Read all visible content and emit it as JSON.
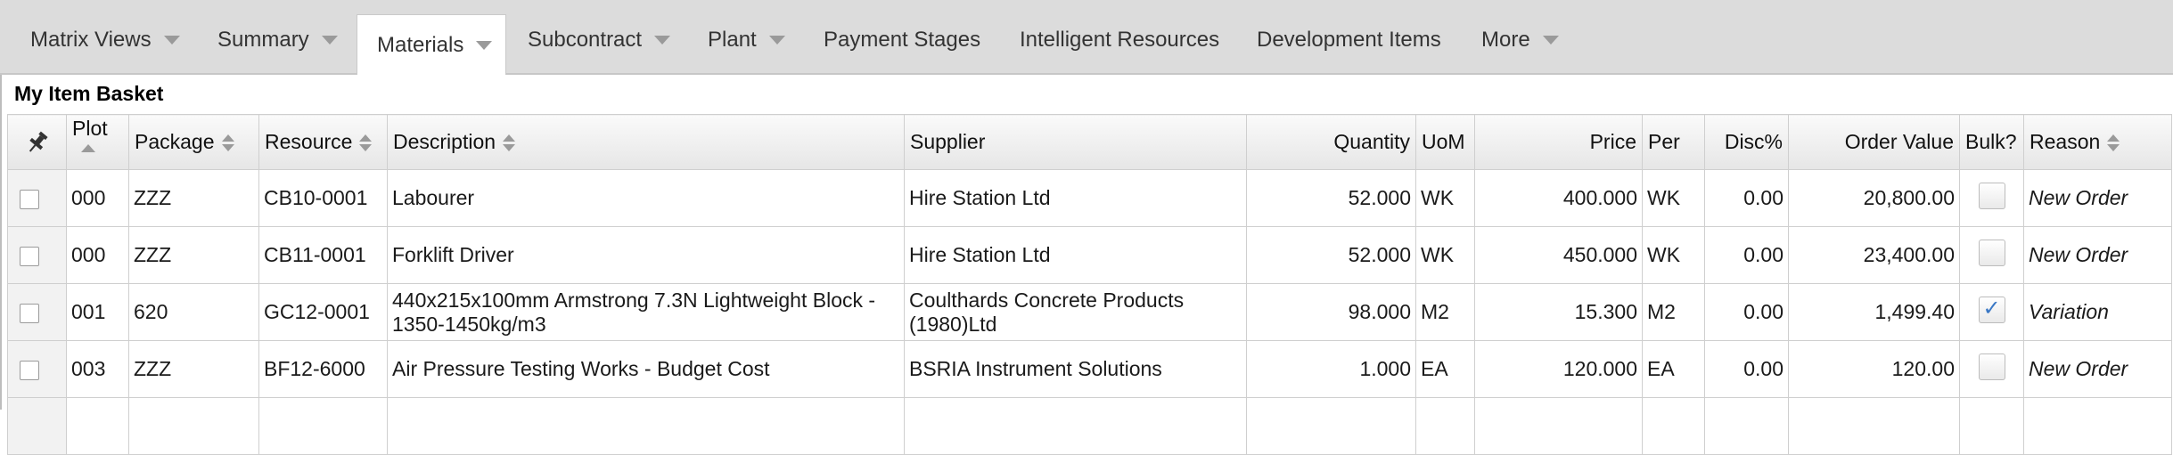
{
  "tabs": [
    {
      "label": "Matrix Views",
      "dropdown": true
    },
    {
      "label": "Summary",
      "dropdown": true
    },
    {
      "label": "Materials",
      "dropdown": true,
      "active": true
    },
    {
      "label": "Subcontract",
      "dropdown": true
    },
    {
      "label": "Plant",
      "dropdown": true
    },
    {
      "label": "Payment Stages",
      "dropdown": false
    },
    {
      "label": "Intelligent Resources",
      "dropdown": false
    },
    {
      "label": "Development Items",
      "dropdown": false
    },
    {
      "label": "More",
      "dropdown": true
    }
  ],
  "basket": {
    "title": "My Item Basket",
    "columns": {
      "plot": "Plot",
      "package": "Package",
      "resource": "Resource",
      "description": "Description",
      "supplier": "Supplier",
      "quantity": "Quantity",
      "uom": "UoM",
      "price": "Price",
      "per": "Per",
      "disc": "Disc%",
      "order_value": "Order Value",
      "bulk": "Bulk?",
      "reason": "Reason"
    },
    "rows": [
      {
        "plot": "000",
        "package": "ZZZ",
        "resource": "CB10-0001",
        "description": "Labourer",
        "supplier": "Hire Station Ltd",
        "quantity": "52.000",
        "uom": "WK",
        "price": "400.000",
        "per": "WK",
        "disc": "0.00",
        "order_value": "20,800.00",
        "bulk": false,
        "reason": "New Order"
      },
      {
        "plot": "000",
        "package": "ZZZ",
        "resource": "CB11-0001",
        "description": "Forklift Driver",
        "supplier": "Hire Station Ltd",
        "quantity": "52.000",
        "uom": "WK",
        "price": "450.000",
        "per": "WK",
        "disc": "0.00",
        "order_value": "23,400.00",
        "bulk": false,
        "reason": "New Order"
      },
      {
        "plot": "001",
        "package": "620",
        "resource": "GC12-0001",
        "description": "440x215x100mm Armstrong 7.3N Lightweight Block - 1350-1450kg/m3",
        "supplier": "Coulthards Concrete Products (1980)Ltd",
        "quantity": "98.000",
        "uom": "M2",
        "price": "15.300",
        "per": "M2",
        "disc": "0.00",
        "order_value": "1,499.40",
        "bulk": true,
        "reason": "Variation"
      },
      {
        "plot": "003",
        "package": "ZZZ",
        "resource": "BF12-6000",
        "description": "Air Pressure Testing Works - Budget Cost",
        "supplier": "BSRIA Instrument Solutions",
        "quantity": "1.000",
        "uom": "EA",
        "price": "120.000",
        "per": "EA",
        "disc": "0.00",
        "order_value": "120.00",
        "bulk": false,
        "reason": "New Order"
      }
    ]
  },
  "icons": {
    "pin": "pin-icon",
    "sort": "sort-arrows-icon",
    "dropdown": "chevron-down-icon"
  },
  "colors": {
    "tabbar": "#dcdcdc",
    "check": "#3a78c5"
  }
}
